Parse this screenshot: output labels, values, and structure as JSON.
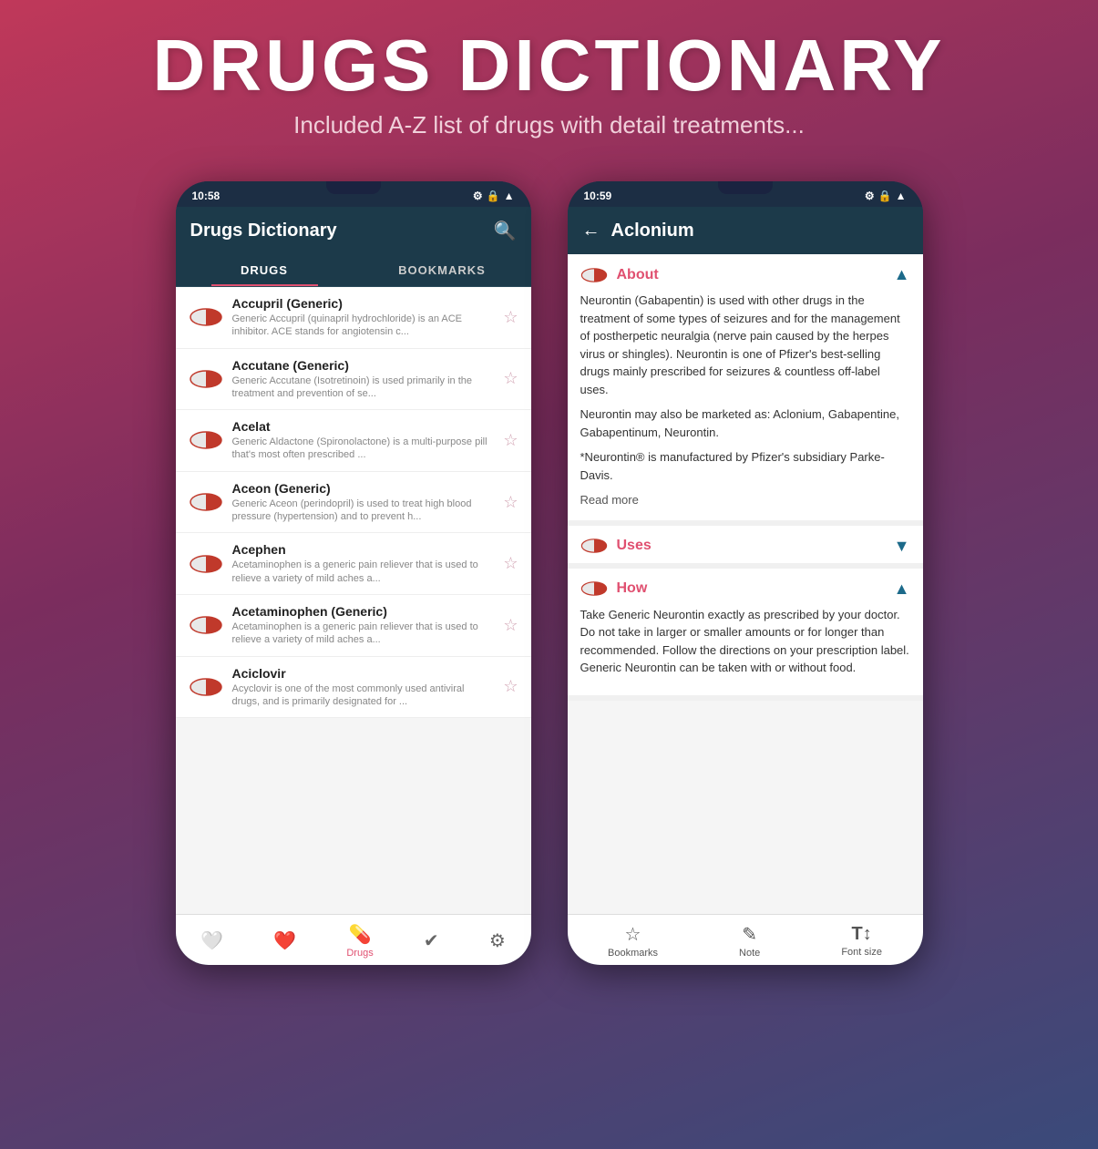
{
  "header": {
    "title": "DRUGS DICTIONARY",
    "subtitle": "Included A-Z list of drugs with detail treatments..."
  },
  "phone_left": {
    "status_time": "10:58",
    "app_title": "Drugs Dictionary",
    "tabs": [
      "DRUGS",
      "BOOKMARKS"
    ],
    "active_tab": 0,
    "drugs": [
      {
        "name": "Accupril (Generic)",
        "desc": "Generic Accupril (quinapril hydrochloride) is an ACE inhibitor. ACE stands for angiotensin c..."
      },
      {
        "name": "Accutane (Generic)",
        "desc": "Generic Accutane (Isotretinoin) is used primarily in the treatment and prevention of se..."
      },
      {
        "name": "Acelat",
        "desc": "Generic Aldactone (Spironolactone) is a multi-purpose pill that's most often prescribed ..."
      },
      {
        "name": "Aceon (Generic)",
        "desc": "Generic Aceon (perindopril) is used to treat high blood pressure (hypertension) and to prevent h..."
      },
      {
        "name": "Acephen",
        "desc": "Acetaminophen is a generic pain reliever that is used to relieve a variety of mild aches a..."
      },
      {
        "name": "Acetaminophen (Generic)",
        "desc": "Acetaminophen is a generic pain reliever that is used to relieve a variety of mild aches a..."
      },
      {
        "name": "Aciclovir",
        "desc": "Acyclovir is one of the most commonly used antiviral drugs, and is primarily designated for ..."
      }
    ],
    "nav_items": [
      {
        "icon": "❤",
        "label": ""
      },
      {
        "icon": "♡",
        "label": ""
      },
      {
        "icon": "💊",
        "label": "Drugs"
      },
      {
        "icon": "✓",
        "label": ""
      },
      {
        "icon": "⚙",
        "label": ""
      }
    ]
  },
  "phone_right": {
    "status_time": "10:59",
    "app_title": "Aclonium",
    "sections": [
      {
        "id": "about",
        "title": "About",
        "expanded": true,
        "chevron": "▲",
        "content": "Neurontin (Gabapentin) is used with other drugs in the treatment of some types of seizures and for the management of postherpetic neuralgia (nerve pain caused by the herpes virus or shingles). Neurontin is one of Pfizer's best-selling drugs mainly prescribed for seizures & countless off-label uses.",
        "extra1": "Neurontin may also be marketed as: Aclonium, Gabapentine, Gabapentinum, Neurontin.",
        "extra2": "*Neurontin® is manufactured by Pfizer's subsidiary Parke-Davis.",
        "read_more": "Read more"
      },
      {
        "id": "uses",
        "title": "Uses",
        "expanded": false,
        "chevron": "▼",
        "content": ""
      },
      {
        "id": "how",
        "title": "How",
        "expanded": true,
        "chevron": "▲",
        "content": "Take Generic Neurontin exactly as prescribed by your doctor. Do not take in larger or smaller amounts or for longer than recommended. Follow the directions on your prescription label. Generic Neurontin can be taken with or without food."
      }
    ],
    "nav_items": [
      {
        "icon": "☆",
        "label": "Bookmarks"
      },
      {
        "icon": "✎",
        "label": "Note"
      },
      {
        "icon": "T↕",
        "label": "Font size"
      }
    ]
  }
}
